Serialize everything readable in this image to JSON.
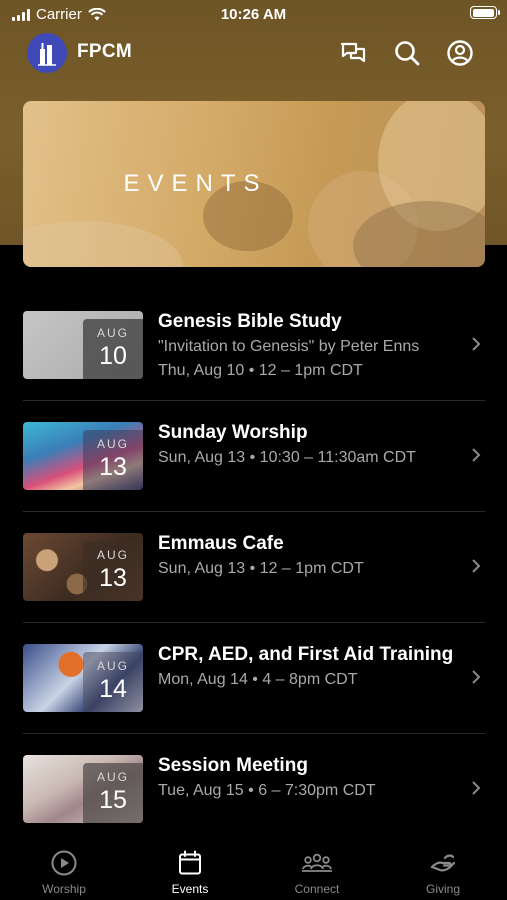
{
  "status_bar": {
    "carrier": "Carrier",
    "time": "10:26 AM"
  },
  "header": {
    "app_name": "FPCM",
    "icons": [
      "chat-icon",
      "search-icon",
      "profile-icon"
    ]
  },
  "banner": {
    "title": "EVENTS"
  },
  "events": [
    {
      "title": "Genesis Bible Study",
      "subtitle": "\"Invitation to Genesis\" by Peter Enns",
      "when": "Thu, Aug 10 • 12 – 1pm CDT",
      "month": "AUG",
      "day": "10"
    },
    {
      "title": "Sunday Worship",
      "when": "Sun, Aug 13 • 10:30 – 11:30am CDT",
      "month": "AUG",
      "day": "13"
    },
    {
      "title": "Emmaus Cafe",
      "when": "Sun, Aug 13 • 12 – 1pm CDT",
      "month": "AUG",
      "day": "13"
    },
    {
      "title": "CPR, AED, and First Aid Training",
      "when": "Mon, Aug 14 • 4 – 8pm CDT",
      "month": "AUG",
      "day": "14"
    },
    {
      "title": "Session Meeting",
      "when": "Tue, Aug 15 • 6 – 7:30pm CDT",
      "month": "AUG",
      "day": "15"
    }
  ],
  "tabs": [
    {
      "label": "Worship",
      "icon": "play-circle-icon"
    },
    {
      "label": "Events",
      "icon": "calendar-icon",
      "active": true
    },
    {
      "label": "Connect",
      "icon": "people-icon"
    },
    {
      "label": "Giving",
      "icon": "hand-icon"
    }
  ],
  "colors": {
    "header_brown": "#7b5f2c",
    "background": "#000000",
    "logo_blue": "#3f49b8",
    "muted_text": "#a9a9a9"
  }
}
